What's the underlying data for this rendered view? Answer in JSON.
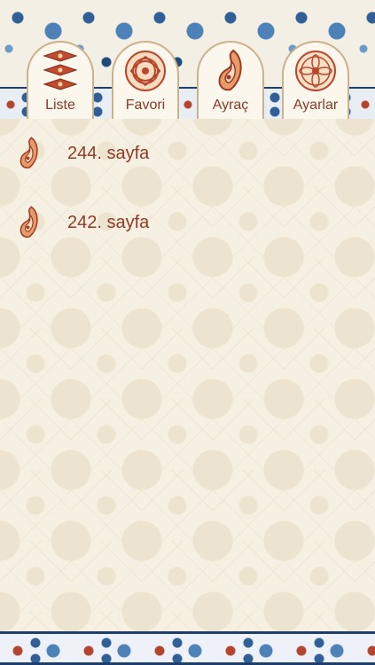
{
  "tabs": [
    {
      "label": "Liste",
      "icon": "list-ornament-icon"
    },
    {
      "label": "Favori",
      "icon": "knot-ornament-icon"
    },
    {
      "label": "Ayraç",
      "icon": "paisley-icon"
    },
    {
      "label": "Ayarlar",
      "icon": "rosette-icon"
    }
  ],
  "bookmarks": [
    {
      "text": "244. sayfa",
      "icon": "paisley-icon"
    },
    {
      "text": "242. sayfa",
      "icon": "paisley-icon"
    }
  ],
  "colors": {
    "accent": "#8f3a24",
    "tile_blue": "#2f5f96",
    "background": "#f6f0e2"
  }
}
